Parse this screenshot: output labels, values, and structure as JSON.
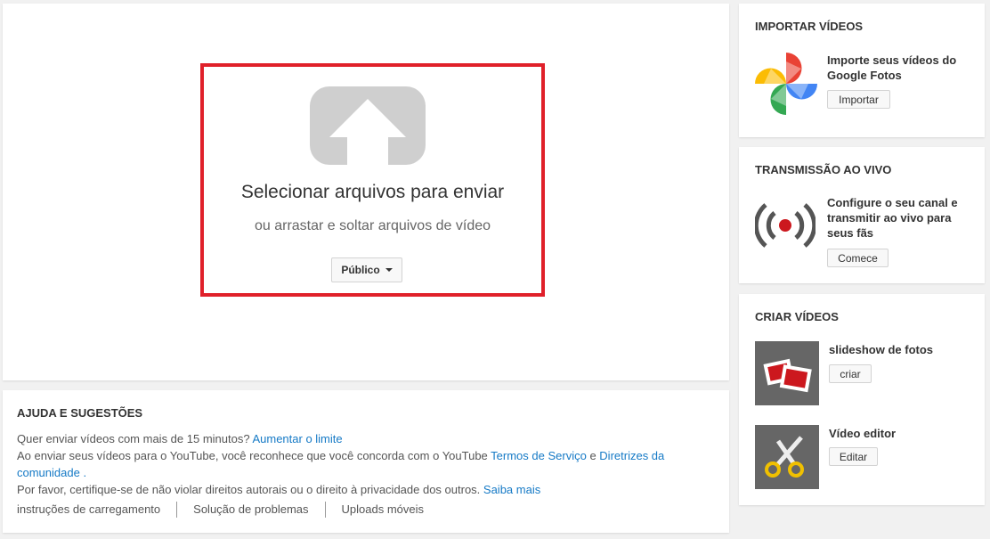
{
  "upload": {
    "title": "Selecionar arquivos para enviar",
    "subtitle": "ou arrastar e soltar arquivos de vídeo",
    "privacy_label": "Público"
  },
  "help": {
    "title": "AJUDA E SUGESTÕES",
    "line1_text": "Quer enviar vídeos com mais de 15 minutos? ",
    "line1_link": "Aumentar o limite",
    "line2_text": "Ao enviar seus vídeos para o YouTube, você reconhece que você concorda com o YouTube ",
    "line2_link1": "Termos de Serviço",
    "line2_and": " e ",
    "line2_link2": "Diretrizes da comunidade .",
    "line3_text": "Por favor, certifique-se de não violar direitos autorais ou o direito à privacidade dos outros. ",
    "line3_link": "Saiba mais",
    "links": [
      "instruções de carregamento",
      "Solução de problemas",
      "Uploads móveis"
    ]
  },
  "import": {
    "title": "IMPORTAR VÍDEOS",
    "text": "Importe seus vídeos do Google Fotos",
    "button": "Importar"
  },
  "live": {
    "title": "TRANSMISSÃO AO VIVO",
    "text": "Configure o seu canal e transmitir ao vivo para seus fãs",
    "button": "Comece"
  },
  "create": {
    "title": "CRIAR VÍDEOS",
    "slideshow_label": "slideshow de fotos",
    "slideshow_button": "criar",
    "editor_label": "Vídeo editor",
    "editor_button": "Editar"
  },
  "colors": {
    "highlight": "#e0202a",
    "link": "#167ac6",
    "live_dot": "#cc181e"
  }
}
